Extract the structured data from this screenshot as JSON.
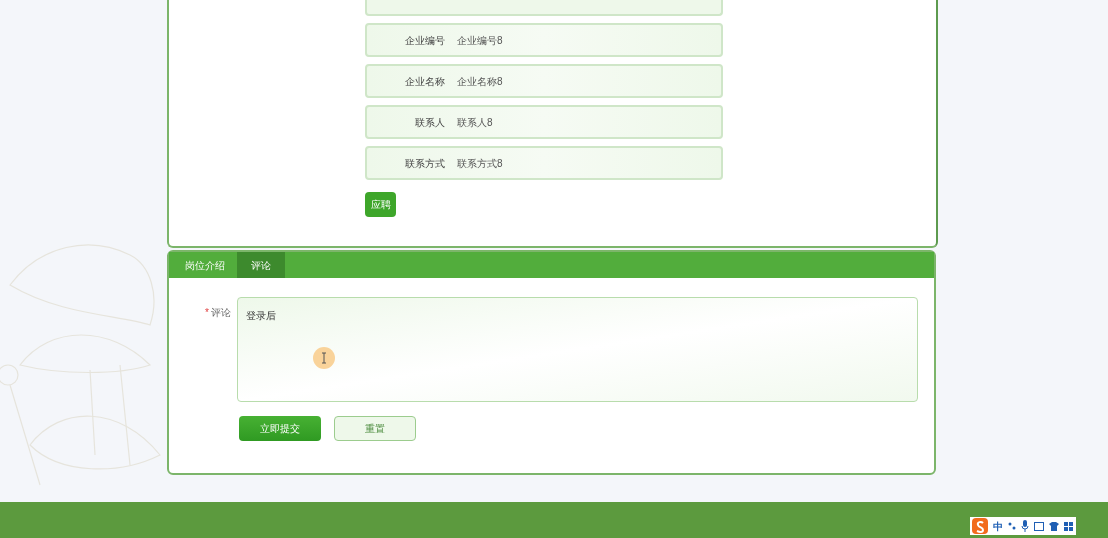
{
  "details": {
    "fields": [
      {
        "label": "企业编号",
        "value": "企业编号8"
      },
      {
        "label": "企业名称",
        "value": "企业名称8"
      },
      {
        "label": "联系人",
        "value": "联系人8"
      },
      {
        "label": "联系方式",
        "value": "联系方式8"
      }
    ],
    "apply_button": "应聘"
  },
  "tabs": [
    {
      "label": "岗位介绍",
      "selected": false
    },
    {
      "label": "评论",
      "selected": true
    }
  ],
  "comment_form": {
    "required_mark": "*",
    "label": "评论",
    "value": "登录后",
    "submit_button": "立即提交",
    "reset_button": "重置"
  },
  "ime_toolbar": {
    "mode": "中"
  }
}
